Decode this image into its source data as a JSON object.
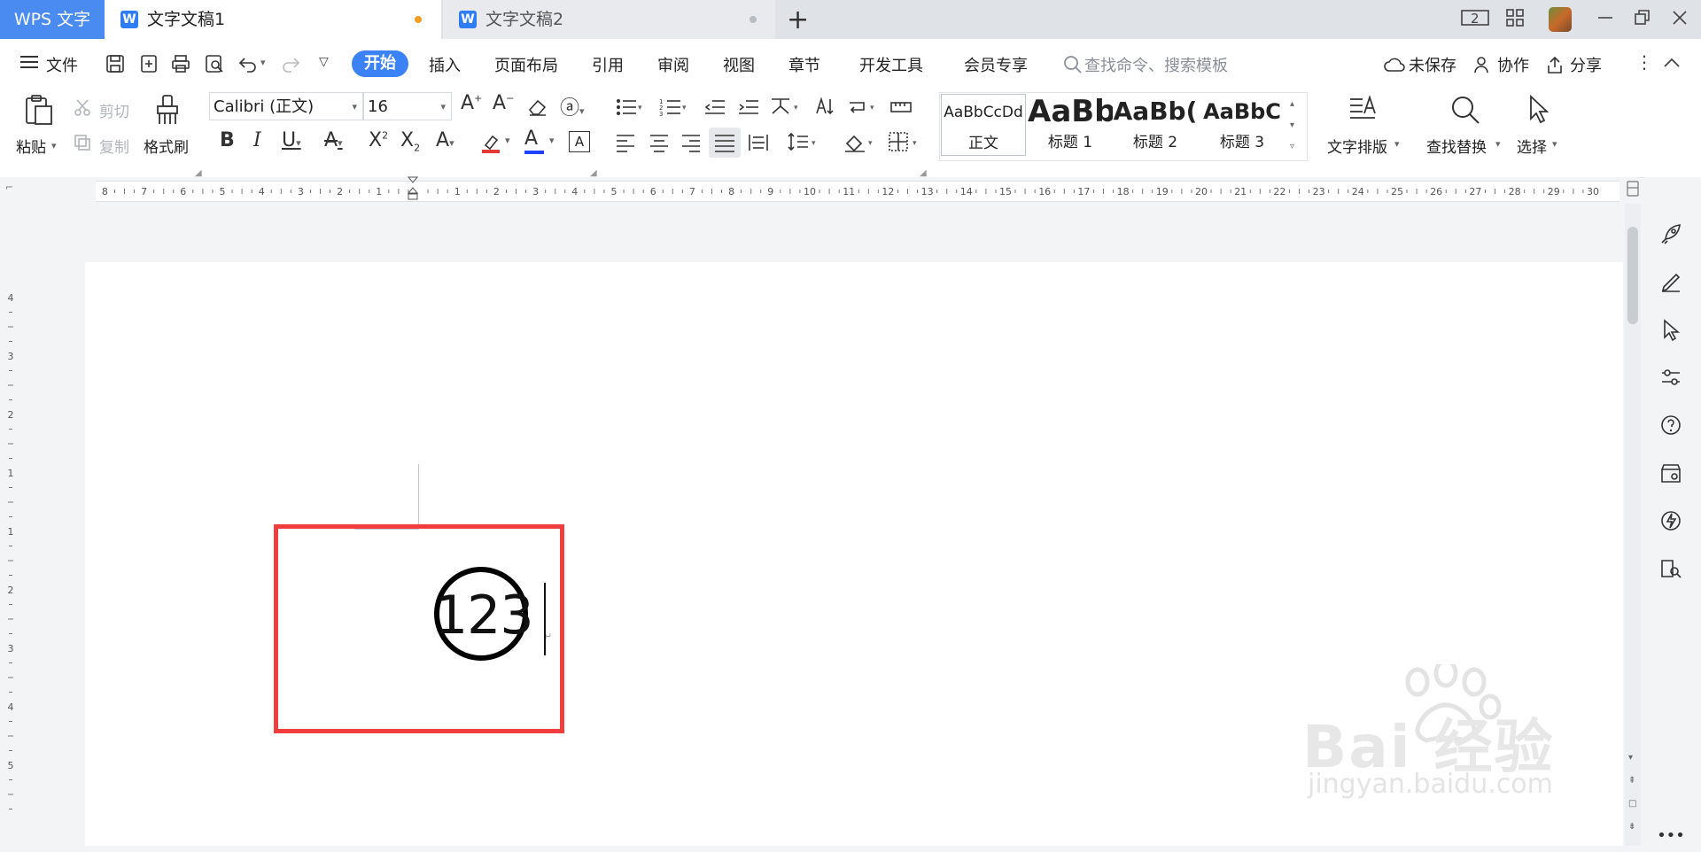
{
  "titlebar": {
    "app_name": "WPS 文字",
    "tabs": [
      {
        "label": "文字文稿1",
        "dot_color": "#f0a020"
      },
      {
        "label": "文字文稿2",
        "dot_color": "#b8bcc4"
      }
    ],
    "new_tab": "+",
    "page_count": "2"
  },
  "menubar": {
    "file": "文件",
    "items": [
      "开始",
      "插入",
      "页面布局",
      "引用",
      "审阅",
      "视图",
      "章节",
      "开发工具",
      "会员专享"
    ],
    "search_placeholder": "查找命令、搜索模板",
    "unsaved": "未保存",
    "collaborate": "协作",
    "share": "分享"
  },
  "ribbon": {
    "paste": "粘贴",
    "cut": "剪切",
    "copy": "复制",
    "format_painter": "格式刷",
    "font_name": "Calibri (正文)",
    "font_size": "16",
    "styles": [
      {
        "sample": "AaBbCcDd",
        "name": "正文"
      },
      {
        "sample": "AaBb",
        "name": "标题 1"
      },
      {
        "sample": "AaBb(",
        "name": "标题 2"
      },
      {
        "sample": "AaBbC",
        "name": "标题 3"
      }
    ],
    "text_layout": "文字排版",
    "find_replace": "查找替换",
    "select": "选择"
  },
  "ruler": {
    "h_labels_left": [
      "8",
      "7",
      "6",
      "5",
      "4",
      "3",
      "2",
      "1"
    ],
    "h_labels_right": [
      "1",
      "2",
      "3",
      "4",
      "5",
      "6",
      "7",
      "8",
      "9",
      "10",
      "11",
      "12",
      "13",
      "14",
      "15",
      "16",
      "17",
      "18",
      "19",
      "20",
      "21",
      "22",
      "23",
      "24",
      "25",
      "26",
      "27",
      "28",
      "29",
      "30"
    ],
    "v_labels": [
      "4",
      "3",
      "2",
      "1",
      "1",
      "2",
      "3",
      "4",
      "5"
    ]
  },
  "document": {
    "enclosed_text": "123"
  },
  "watermark": {
    "line1": "Bai 经验",
    "line2": "jingyan.baidu.com"
  }
}
